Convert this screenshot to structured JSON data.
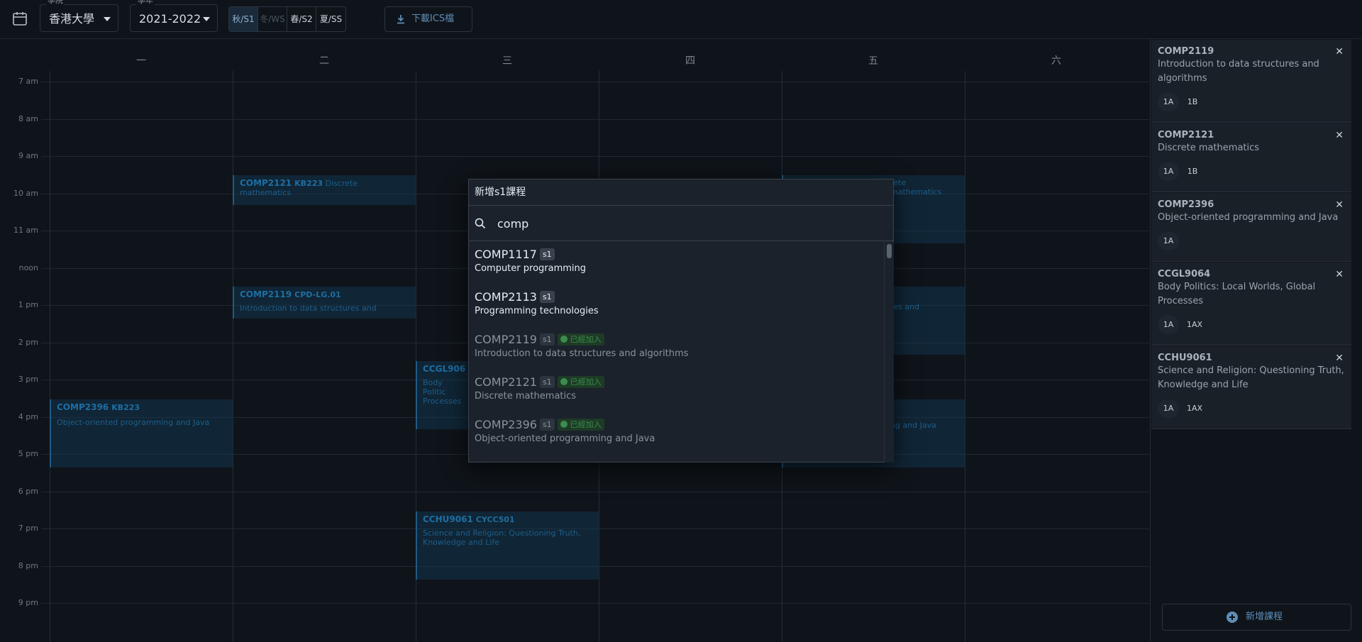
{
  "topbar": {
    "university_label": "學院",
    "university_value": "香港大學",
    "year_label": "學年",
    "year_value": "2021-2022",
    "semesters": [
      "秋/S1",
      "冬/WS",
      "春/S2",
      "夏/SS"
    ],
    "active_semester": "秋/S1",
    "download_label": "下載ICS檔"
  },
  "calendar": {
    "days": [
      "一",
      "二",
      "三",
      "四",
      "五",
      "六"
    ],
    "times": [
      "7 am",
      "8 am",
      "9 am",
      "10 am",
      "11 am",
      "noon",
      "1 pm",
      "2 pm",
      "3 pm",
      "4 pm",
      "5 pm",
      "6 pm",
      "7 pm",
      "8 pm",
      "9 pm"
    ],
    "events": [
      {
        "code": "COMP2121",
        "room": "KB223",
        "title": "Discrete mathematics"
      },
      {
        "code": "COMP2119",
        "room": "CPD-LG.01",
        "title": "Introduction to data structures and"
      },
      {
        "code": "CCGL906",
        "room": "",
        "title": "Body Politic Processes"
      },
      {
        "code": "COMP2396",
        "room": "KB223",
        "title": "Object-oriented programming and Java"
      },
      {
        "code": "CCHU9061",
        "room": "CYCC501",
        "title": "Science and Religion: Questioning Truth, Knowledge and Life"
      },
      {
        "code": "",
        "room": "",
        "title": "rete mathematics"
      },
      {
        "code": "",
        "room": "",
        "title": "res and"
      },
      {
        "code": "",
        "room": "",
        "title": "ng and Java"
      }
    ]
  },
  "sidebar": {
    "courses": [
      {
        "code": "COMP2119",
        "name": "Introduction to data structures and algorithms",
        "sections": [
          "1A",
          "1B"
        ]
      },
      {
        "code": "COMP2121",
        "name": "Discrete mathematics",
        "sections": [
          "1A",
          "1B"
        ]
      },
      {
        "code": "COMP2396",
        "name": "Object-oriented programming and Java",
        "sections": [
          "1A"
        ]
      },
      {
        "code": "CCGL9064",
        "name": "Body Politics: Local Worlds, Global Processes",
        "sections": [
          "1A",
          "1AX"
        ]
      },
      {
        "code": "CCHU9061",
        "name": "Science and Religion: Questioning Truth, Knowledge and Life",
        "sections": [
          "1A",
          "1AX"
        ]
      }
    ],
    "close_glyph": "✕",
    "add_course_label": "新增課程"
  },
  "dialog": {
    "title": "新增s1課程",
    "search_value": "comp",
    "results": [
      {
        "code": "COMP1117",
        "sem": "s1",
        "name": "Computer programming",
        "added": ""
      },
      {
        "code": "COMP2113",
        "sem": "s1",
        "name": "Programming technologies",
        "added": ""
      },
      {
        "code": "COMP2119",
        "sem": "s1",
        "name": "Introduction to data structures and algorithms",
        "added": "已經加入"
      },
      {
        "code": "COMP2121",
        "sem": "s1",
        "name": "Discrete mathematics",
        "added": "已經加入"
      },
      {
        "code": "COMP2396",
        "sem": "s1",
        "name": "Object-oriented programming and Java",
        "added": "已經加入"
      }
    ]
  },
  "colors": {
    "background": "#0f141a",
    "accent": "#5e8db8",
    "event_fill": "#14465a",
    "added_green": "#3b8c4d"
  }
}
